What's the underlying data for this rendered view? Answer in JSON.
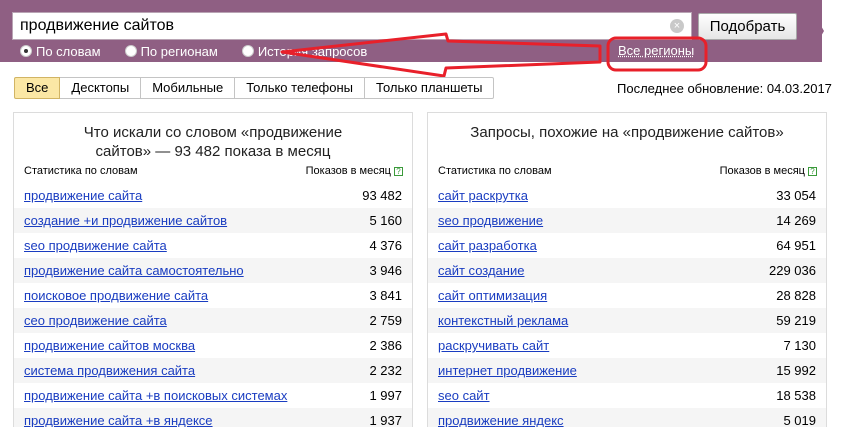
{
  "search": {
    "query": "продвижение сайтов",
    "submit_label": "Подобрать"
  },
  "modes": [
    {
      "label": "По словам",
      "checked": true
    },
    {
      "label": "По регионам",
      "checked": false
    },
    {
      "label": "История запросов",
      "checked": false
    }
  ],
  "regions_link": "Все регионы",
  "tabs": [
    "Все",
    "Десктопы",
    "Мобильные",
    "Только телефоны",
    "Только планшеты"
  ],
  "last_update": "Последнее обновление: 04.03.2017",
  "left_panel": {
    "title": "Что искали со словом «продвижение сайтов» — 93 482 показа в месяц",
    "col_keyword": "Статистика по словам",
    "col_count": "Показов в месяц",
    "rows": [
      {
        "phrase": "продвижение сайта",
        "count": "93 482"
      },
      {
        "phrase": "создание +и продвижение сайтов",
        "count": "5 160"
      },
      {
        "phrase": "seo продвижение сайта",
        "count": "4 376"
      },
      {
        "phrase": "продвижение сайта самостоятельно",
        "count": "3 946"
      },
      {
        "phrase": "поисковое продвижение сайта",
        "count": "3 841"
      },
      {
        "phrase": "сео продвижение сайта",
        "count": "2 759"
      },
      {
        "phrase": "продвижение сайтов москва",
        "count": "2 386"
      },
      {
        "phrase": "система продвижения сайта",
        "count": "2 232"
      },
      {
        "phrase": "продвижение сайта +в поисковых системах",
        "count": "1 997"
      },
      {
        "phrase": "продвижение сайта +в яндексе",
        "count": "1 937"
      }
    ]
  },
  "right_panel": {
    "title": "Запросы, похожие на «продвижение сайтов»",
    "col_keyword": "Статистика по словам",
    "col_count": "Показов в месяц",
    "rows": [
      {
        "phrase": "сайт раскрутка",
        "count": "33 054"
      },
      {
        "phrase": "seo продвижение",
        "count": "14 269"
      },
      {
        "phrase": "сайт разработка",
        "count": "64 951"
      },
      {
        "phrase": "сайт создание",
        "count": "229 036"
      },
      {
        "phrase": "сайт оптимизация",
        "count": "28 828"
      },
      {
        "phrase": "контекстный реклама",
        "count": "59 219"
      },
      {
        "phrase": "раскручивать сайт",
        "count": "7 130"
      },
      {
        "phrase": "интернет продвижение",
        "count": "15 992"
      },
      {
        "phrase": "seo сайт",
        "count": "18 538"
      },
      {
        "phrase": "продвижение яндекс",
        "count": "5 019"
      }
    ]
  },
  "colors": {
    "header": "#8f5f83",
    "link": "#1a3dc1",
    "annotation": "#e8202a",
    "active_tab": "#fbe7a5"
  }
}
